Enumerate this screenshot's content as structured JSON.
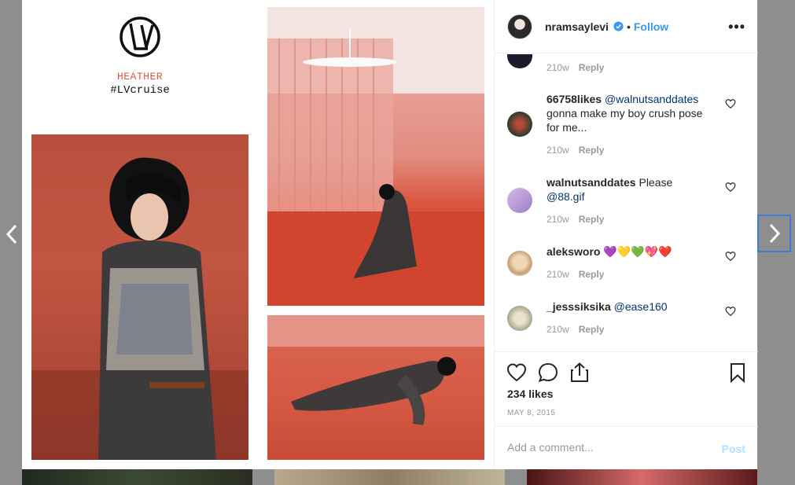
{
  "post": {
    "username": "nramsaylevi",
    "follow_label": "Follow",
    "separator": "•",
    "more_label": "•••",
    "likes": "234 likes",
    "date": "MAY 8, 2015"
  },
  "collage": {
    "heather": "HEATHER",
    "hashtag": "#LVcruise"
  },
  "comments": [
    {
      "user": "",
      "text": "",
      "mention": "",
      "time": "210w",
      "reply": "Reply"
    },
    {
      "user": "66758likes",
      "mention": "@walnutsanddates",
      "text": "gonna make my boy crush pose for me...",
      "time": "210w",
      "reply": "Reply"
    },
    {
      "user": "walnutsanddates",
      "text": "Please",
      "mention": "@88.gif",
      "time": "210w",
      "reply": "Reply"
    },
    {
      "user": "aleksworo",
      "text": "💜💛💚💖❤️",
      "mention": "",
      "time": "210w",
      "reply": "Reply"
    },
    {
      "user": "_jesssiksika",
      "text": "",
      "mention": "@ease160",
      "time": "210w",
      "reply": "Reply"
    }
  ],
  "add_comment": {
    "placeholder": "Add a comment...",
    "post_label": "Post"
  },
  "colors": {
    "accent": "#3897f0",
    "verified": "#3897f0",
    "post_disabled": "#b2dffc"
  }
}
